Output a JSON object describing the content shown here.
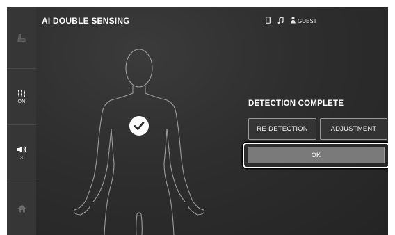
{
  "screen": {
    "title": "AI DOUBLE SENSING"
  },
  "status_bar": {
    "phone_icon": "phone-icon",
    "music_icon": "music-note-icon",
    "user_icon": "user-icon",
    "user_label": "GUEST"
  },
  "sidebar": {
    "items": [
      {
        "icon": "massage-chair-icon",
        "label": ""
      },
      {
        "icon": "heat-icon",
        "label": "ON"
      },
      {
        "icon": "volume-icon",
        "label": "3"
      },
      {
        "icon": "home-icon",
        "label": ""
      }
    ]
  },
  "detection": {
    "status_title": "DETECTION COMPLETE",
    "check_icon": "checkmark-icon",
    "redetect_label": "RE-DETECTION",
    "adjust_label": "ADJUSTMENT",
    "ok_label": "OK"
  },
  "colors": {
    "background": "#2a2a2a",
    "sidebar": "#363636",
    "ok_button": "#7a7a7a",
    "text": "#ffffff"
  }
}
